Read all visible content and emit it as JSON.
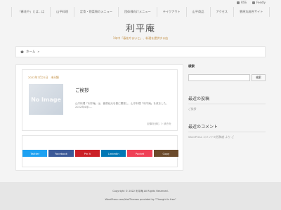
{
  "topbar": {
    "rss": "RSS",
    "feedly": "Feedly"
  },
  "gnav": [
    "「春花や」とは…は",
    "山平料理",
    "定食・惣菜物のメニュー",
    "団体様向けメニュー",
    "テイクアウト",
    "山平商品",
    "アクセス",
    "菅原丸総合サイト"
  ],
  "site": {
    "title": "利平庵",
    "description": "1年中「春花やまいと」、料理を提供する店"
  },
  "breadcrumb": {
    "home": "ホーム",
    "sep": "»"
  },
  "post": {
    "date": "2022年7月22日",
    "category": "未分類",
    "thumb_text": "No Image",
    "title": "ご挨拶",
    "excerpt": "山平料理「利平庵」は、菅原紀元を基に開発し、山平料理「利平庵」を改ました。2022年4月1…",
    "more": "記事を読む ＞ 続きを"
  },
  "share": [
    {
      "label": "Twitter",
      "color": "#1da1f2"
    },
    {
      "label": "Facebook",
      "color": "#3b5998"
    },
    {
      "label": "Pin it",
      "color": "#cb2027"
    },
    {
      "label": "LinkedIn",
      "color": "#0077b5"
    },
    {
      "label": "Pocket",
      "color": "#ef4056"
    },
    {
      "label": "Copy",
      "color": "#6b4a2b"
    }
  ],
  "sidebar": {
    "search_label": "検索",
    "search_button": "検索",
    "recent_posts_heading": "最近の投稿",
    "recent_post": "ご挨拶",
    "recent_comments_heading": "最近のコメント",
    "recent_comment": "WordPress コメントの投稿者 より ご"
  },
  "footer": {
    "copyright": "Copyright © 2022 利平庵 All Rights Reserved.",
    "powered": "WordPress.com/ktaiThemes provided by \"Thought is free\""
  }
}
